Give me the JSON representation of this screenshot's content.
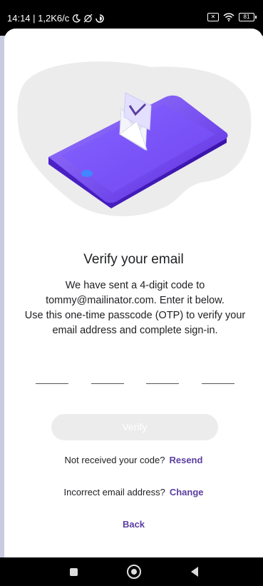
{
  "status_bar": {
    "time_info": "14:14 | 1,2K6/c",
    "sim": "✕",
    "battery": "81"
  },
  "content": {
    "title": "Verify your email",
    "description_lines": [
      "We have sent a 4-digit code to",
      "tommy@mailinator.com. Enter it below.",
      "Use this one-time passcode (OTP) to verify your",
      "email address and complete sign-in."
    ],
    "otp_digits": [
      "",
      "",
      "",
      ""
    ],
    "verify_label": "Verify",
    "resend_prompt": "Not received your code?",
    "resend_label": "Resend",
    "change_prompt": "Incorrect email address?",
    "change_label": "Change",
    "back_label": "Back"
  },
  "colors": {
    "accent": "#5b3fa0",
    "phone": "#6a3cf0",
    "blob": "#ececec"
  },
  "icons": {
    "status": [
      "moon-icon",
      "muted-alarm-icon",
      "data-saver-icon",
      "sim-icon",
      "wifi-icon",
      "battery-icon"
    ],
    "nav": [
      "recents-square-icon",
      "home-circle-icon",
      "back-triangle-icon"
    ]
  }
}
